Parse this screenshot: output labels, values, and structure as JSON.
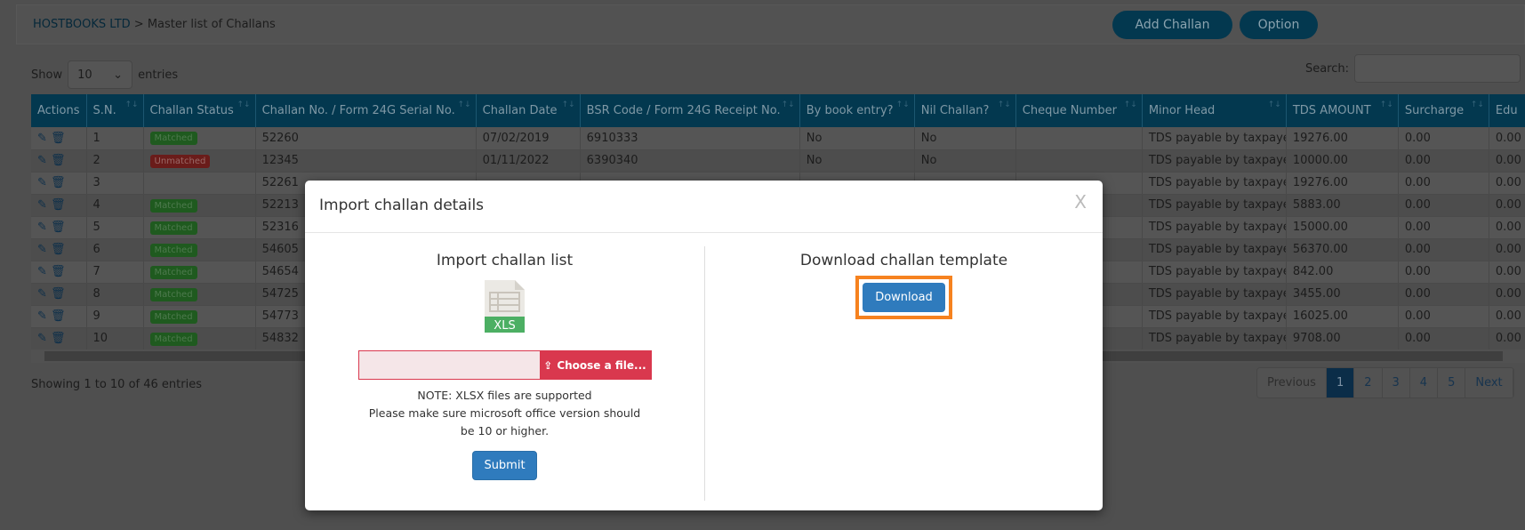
{
  "header": {
    "company": "HOSTBOOKS LTD",
    "separator": " > ",
    "page": "Master list of Challans",
    "add_challan": "Add Challan",
    "option": "Option"
  },
  "controls": {
    "show": "Show",
    "entries_value": "10",
    "entries": "entries",
    "search_label": "Search:",
    "search_value": ""
  },
  "table": {
    "columns": [
      "Actions",
      "S.N.",
      "Challan Status",
      "Challan No. / Form 24G Serial No.",
      "Challan Date",
      "BSR Code / Form 24G Receipt No.",
      "By book entry?",
      "Nil Challan?",
      "Cheque Number",
      "Minor Head",
      "TDS AMOUNT",
      "Surcharge",
      "Edu"
    ],
    "rows": [
      {
        "sn": "1",
        "status": "Matched",
        "challan_no": "52260",
        "date": "07/02/2019",
        "bsr": "6910333",
        "book": "No",
        "nil": "No",
        "cheque": "",
        "minor": "TDS payable by taxpayer",
        "tds": "19276.00",
        "surcharge": "0.00",
        "edu": "0.00"
      },
      {
        "sn": "2",
        "status": "Unmatched",
        "challan_no": "12345",
        "date": "01/11/2022",
        "bsr": "6390340",
        "book": "No",
        "nil": "No",
        "cheque": "",
        "minor": "TDS payable by taxpayer",
        "tds": "10000.00",
        "surcharge": "0.00",
        "edu": "0.00"
      },
      {
        "sn": "3",
        "status": "",
        "challan_no": "52261",
        "date": "",
        "bsr": "",
        "book": "",
        "nil": "",
        "cheque": "",
        "minor": "TDS payable by taxpayer",
        "tds": "19276.00",
        "surcharge": "0.00",
        "edu": "0.00"
      },
      {
        "sn": "4",
        "status": "Matched",
        "challan_no": "52213",
        "date": "",
        "bsr": "",
        "book": "",
        "nil": "",
        "cheque": "",
        "minor": "TDS payable by taxpayer",
        "tds": "5883.00",
        "surcharge": "0.00",
        "edu": "0.00"
      },
      {
        "sn": "5",
        "status": "Matched",
        "challan_no": "52316",
        "date": "",
        "bsr": "",
        "book": "",
        "nil": "",
        "cheque": "",
        "minor": "TDS payable by taxpayer",
        "tds": "15000.00",
        "surcharge": "0.00",
        "edu": "0.00"
      },
      {
        "sn": "6",
        "status": "Matched",
        "challan_no": "54605",
        "date": "",
        "bsr": "",
        "book": "",
        "nil": "",
        "cheque": "",
        "minor": "TDS payable by taxpayer",
        "tds": "56370.00",
        "surcharge": "0.00",
        "edu": "0.00"
      },
      {
        "sn": "7",
        "status": "Matched",
        "challan_no": "54654",
        "date": "",
        "bsr": "",
        "book": "",
        "nil": "",
        "cheque": "",
        "minor": "TDS payable by taxpayer",
        "tds": "842.00",
        "surcharge": "0.00",
        "edu": "0.00"
      },
      {
        "sn": "8",
        "status": "Matched",
        "challan_no": "54725",
        "date": "",
        "bsr": "",
        "book": "",
        "nil": "",
        "cheque": "",
        "minor": "TDS payable by taxpayer",
        "tds": "3455.00",
        "surcharge": "0.00",
        "edu": "0.00"
      },
      {
        "sn": "9",
        "status": "Matched",
        "challan_no": "54773",
        "date": "",
        "bsr": "",
        "book": "",
        "nil": "",
        "cheque": "",
        "minor": "TDS payable by taxpayer",
        "tds": "16025.00",
        "surcharge": "0.00",
        "edu": "0.00"
      },
      {
        "sn": "10",
        "status": "Matched",
        "challan_no": "54832",
        "date": "",
        "bsr": "",
        "book": "",
        "nil": "",
        "cheque": "",
        "minor": "TDS payable by taxpayer",
        "tds": "9708.00",
        "surcharge": "0.00",
        "edu": "0.00"
      }
    ]
  },
  "footer": {
    "showing": "Showing 1 to 10 of 46 entries",
    "previous": "Previous",
    "pages": [
      "1",
      "2",
      "3",
      "4",
      "5"
    ],
    "current_page": "1",
    "next": "Next"
  },
  "modal": {
    "title": "Import challan details",
    "close": "X",
    "import_title": "Import challan list",
    "file_badge": "XLS",
    "choose_file": "Choose a file...",
    "note_line1": "NOTE: XLSX files are supported",
    "note_line2": "Please make sure microsoft office version should be 10 or higher.",
    "submit": "Submit",
    "download_title": "Download challan template",
    "download": "Download"
  },
  "colors": {
    "table_header": "#0a7ca5",
    "primary_button": "#2f7bbd",
    "choose_file": "#d9384e",
    "highlight": "#f6821f",
    "matched": "#3c8f3c",
    "unmatched": "#c9302c"
  }
}
